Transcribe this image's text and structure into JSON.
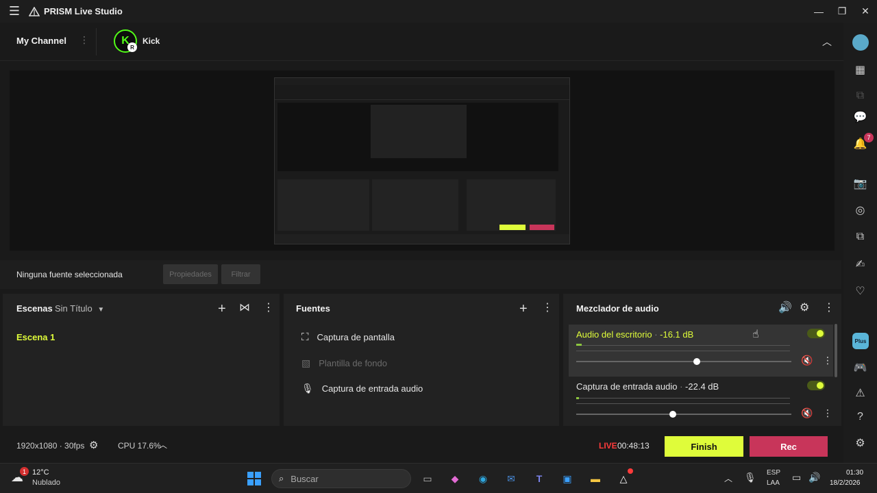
{
  "app": {
    "title": "PRISM Live Studio"
  },
  "channel": {
    "name": "My Channel",
    "platform": "Kick",
    "platform_letter": "K",
    "badge_letter": "R"
  },
  "properties_bar": {
    "label": "Ninguna fuente seleccionada",
    "properties_btn": "Propiedades",
    "filter_btn": "Filtrar"
  },
  "scenes": {
    "title": "Escenas",
    "collection": "Sin Título",
    "items": [
      "Escena 1"
    ]
  },
  "sources": {
    "title": "Fuentes",
    "items": [
      "Captura de pantalla",
      "Plantilla de fondo",
      "Captura de entrada audio"
    ]
  },
  "mixer": {
    "title": "Mezclador de audio",
    "channels": [
      {
        "name": "Audio del escritorio",
        "level": "-16.1 dB",
        "volume": 0.56
      },
      {
        "name": "Captura de entrada audio",
        "level": "-22.4 dB",
        "volume": 0.45
      }
    ]
  },
  "status": {
    "resolution": "1920x1080 · 30fps",
    "cpu": "CPU 17.6%",
    "live_label": "LIVE",
    "live_time": "00:48:13",
    "finish_btn": "Finish",
    "rec_btn": "Rec"
  },
  "sidebar": {
    "notification_count": "7",
    "plus_label": "Plus"
  },
  "taskbar": {
    "weather_temp": "12°C",
    "weather_desc": "Nublado",
    "weather_badge": "1",
    "search_placeholder": "Buscar",
    "lang_line1": "ESP",
    "lang_line2": "LAA",
    "time": "01:30",
    "date": "18/2/2026"
  },
  "colors": {
    "accent": "#dffc3a",
    "rec": "#c8355a",
    "live": "#ff3b3b",
    "kick": "#53fc18"
  }
}
